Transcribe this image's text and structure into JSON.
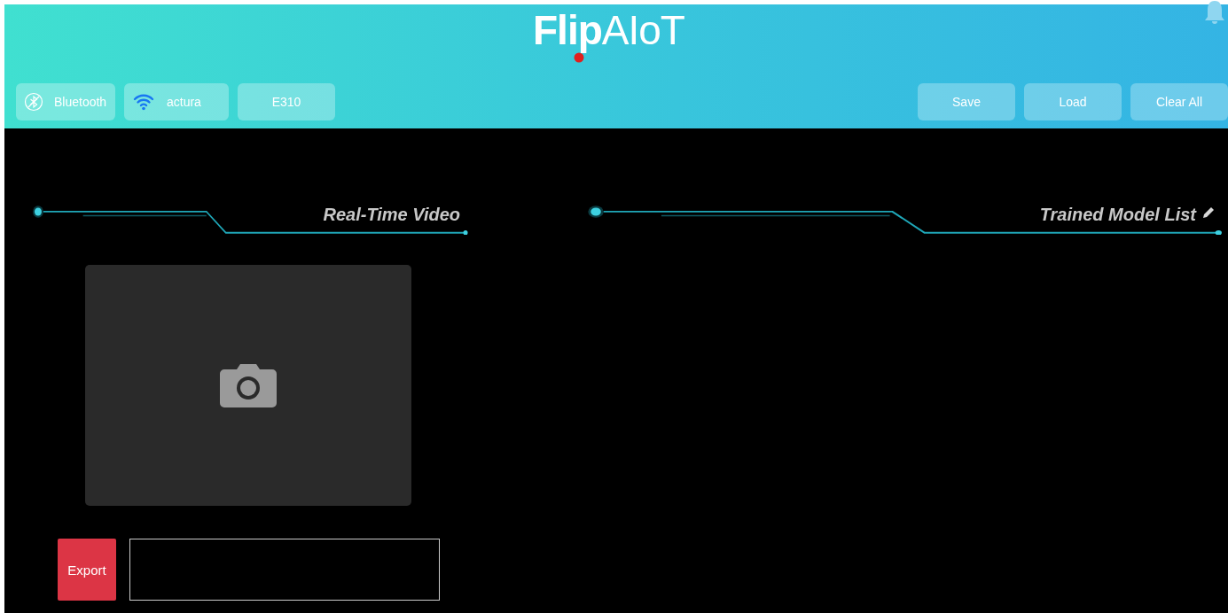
{
  "header": {
    "logo": "**Flip**AIoT",
    "left_buttons": [
      {
        "kind": "bluetooth",
        "label": "Bluetooth"
      },
      {
        "kind": "wifi",
        "label": "actura"
      },
      {
        "kind": "plain",
        "label": "E310"
      }
    ],
    "right_buttons": [
      "Save",
      "Load",
      "Clear All"
    ]
  },
  "panels": [
    {
      "kind": "video",
      "title": "Real-Time Video",
      "export_button": "Export"
    },
    {
      "kind": "list",
      "title": "Trained Model List"
    }
  ]
}
